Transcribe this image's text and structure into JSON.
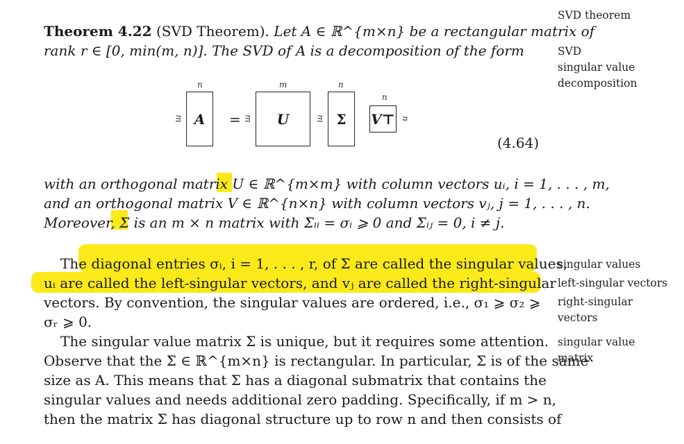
{
  "margin_notes": {
    "svd_theorem": "SVD theorem",
    "svd": "SVD",
    "svd_full_1": "singular value",
    "svd_full_2": "decomposition",
    "sv": "singular values",
    "lsv": "left-singular vectors",
    "rsv_1": "right-singular",
    "rsv_2": "vectors",
    "svm_1": "singular value",
    "svm_2": "matrix"
  },
  "theorem": {
    "label": "Theorem 4.22",
    "name": "(SVD Theorem).",
    "line1_rest": "Let A ∈ ℝ^{m×n} be a rectangular matrix of",
    "line2": "rank r ∈ [0, min(m, n)]. The SVD of A is a decomposition of the form"
  },
  "figure": {
    "mat_A": "A",
    "mat_U": "U",
    "mat_S": "Σ",
    "mat_V": "V⊤",
    "dim_n": "n",
    "dim_m": "m",
    "equals": "=",
    "eq_number": "(4.64)"
  },
  "para1": {
    "l1": "with an orthogonal matrix U ∈ ℝ^{m×m} with column vectors uᵢ, i = 1, . . . , m,",
    "l2": "and an orthogonal matrix V ∈ ℝ^{n×n} with column vectors vⱼ, j = 1, . . . , n.",
    "l3": "Moreover, Σ is an m × n matrix with Σᵢᵢ = σᵢ ⩾ 0 and Σᵢⱼ = 0, i ≠ j."
  },
  "para2": {
    "l1": "The diagonal entries σᵢ, i = 1, . . . , r, of Σ are called the singular values,",
    "l2": "uᵢ are called the left-singular vectors, and vⱼ are called the right-singular",
    "l3": "vectors. By convention, the singular values are ordered, i.e., σ₁ ⩾ σ₂ ⩾",
    "l4": "σᵣ ⩾ 0."
  },
  "para3": {
    "l1": "The singular value matrix Σ is unique, but it requires some attention.",
    "l2": "Observe that the Σ ∈ ℝ^{m×n} is rectangular. In particular, Σ is of the same",
    "l3": "size as A. This means that Σ has a diagonal submatrix that contains the",
    "l4": "singular values and needs additional zero padding. Specifically, if m > n,",
    "l5": "then the matrix Σ has diagonal structure up to row n and then consists of"
  }
}
